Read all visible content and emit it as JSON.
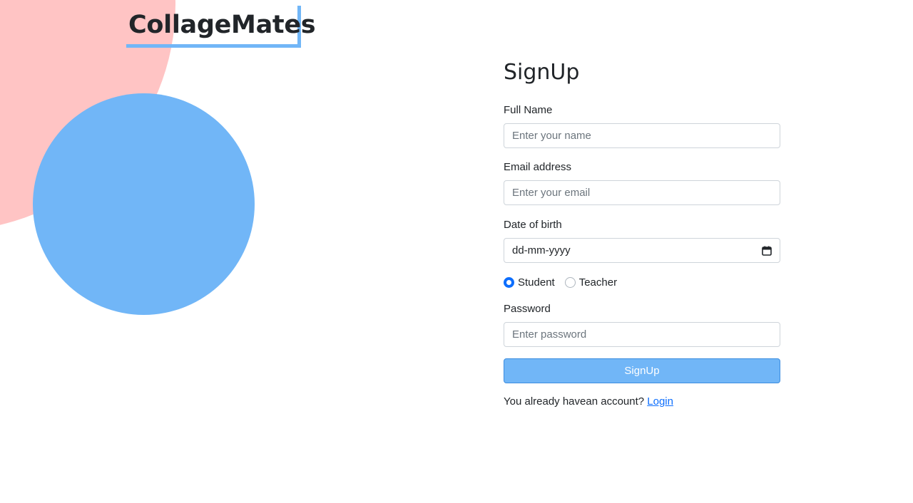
{
  "brand": {
    "name": "CollageMates"
  },
  "form": {
    "title": "SignUp",
    "full_name": {
      "label": "Full Name",
      "placeholder": "Enter your name",
      "value": ""
    },
    "email": {
      "label": "Email address",
      "placeholder": "Enter your email",
      "value": ""
    },
    "dob": {
      "label": "Date of birth",
      "display": "dd-mm-yyyy",
      "icon": "calendar-icon"
    },
    "role": {
      "options": [
        {
          "label": "Student",
          "checked": true
        },
        {
          "label": "Teacher",
          "checked": false
        }
      ]
    },
    "password": {
      "label": "Password",
      "placeholder": "Enter password",
      "value": ""
    },
    "submit_label": "SignUp",
    "footer": {
      "text": "You already havean account? ",
      "link_label": "Login"
    }
  },
  "colors": {
    "accent": "#71b6f7",
    "pink": "#ffc4c4",
    "link": "#0d6efd"
  }
}
